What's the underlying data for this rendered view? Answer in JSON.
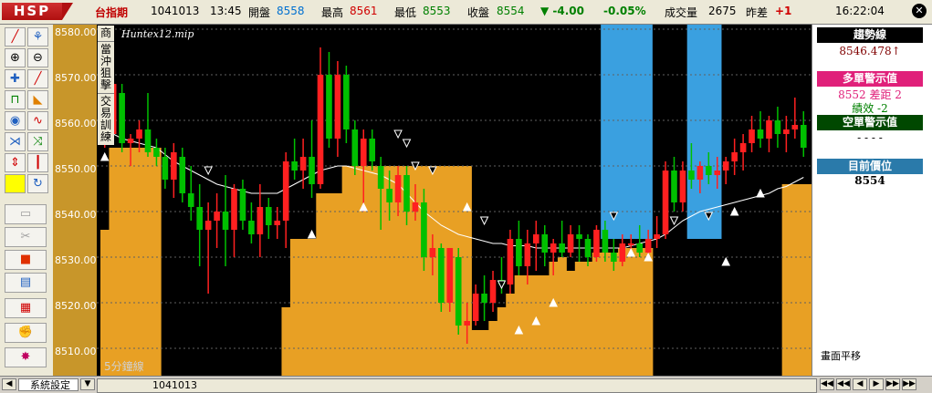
{
  "header": {
    "logo": "HSP",
    "index_name": "台指期",
    "date": "1041013",
    "time": "13:45",
    "open_label": "開盤",
    "open": "8558",
    "high_label": "最高",
    "high": "8561",
    "low_label": "最低",
    "low": "8553",
    "close_label": "收盤",
    "close": "8554",
    "change": "▼ -4.00",
    "change_pct": "-0.05%",
    "volume_label": "成交量",
    "volume": "2675",
    "diff_label": "昨差",
    "diff": "+1",
    "clock": "16:22:04",
    "close_icon": "✕"
  },
  "toolbar": {
    "icons": [
      "line-draw-icon",
      "trend-icon",
      "zoom-in-icon",
      "zoom-out-icon",
      "crosshair-icon",
      "ruler-icon",
      "lock-icon",
      "pencil-icon",
      "indicator-icon",
      "wave-icon",
      "fan-icon",
      "cross-arrows-icon",
      "updown-icon",
      "candles-icon",
      "color-square-icon",
      "refresh-icon",
      "folder-icon",
      "scissors-icon",
      "stop-icon",
      "calendar-icon",
      "table-icon",
      "gloves-icon",
      "star-icon"
    ]
  },
  "chart": {
    "title": "Huntex12.mip",
    "side_label": [
      "商",
      "當沖狙擊",
      "交易訓練"
    ],
    "period": "5分鐘線",
    "y_ticks": [
      "8580.00",
      "8570.00",
      "8560.00",
      "8550.00",
      "8540.00",
      "8530.00",
      "8520.00",
      "8510.00"
    ]
  },
  "chart_data": {
    "type": "candlestick",
    "title": "",
    "ylim": [
      8506,
      8582
    ],
    "y_ticks": [
      8580,
      8570,
      8560,
      8550,
      8540,
      8530,
      8520,
      8510
    ],
    "candles": [
      [
        8556.5,
        8560,
        8554,
        8557
      ],
      [
        8557,
        8572,
        8555,
        8568
      ],
      [
        8566,
        8568,
        8553,
        8555
      ],
      [
        8555,
        8557,
        8550,
        8556
      ],
      [
        8556,
        8560,
        8553,
        8558
      ],
      [
        8558,
        8566,
        8552,
        8553
      ],
      [
        8554,
        8556,
        8550,
        8552
      ],
      [
        8552,
        8554,
        8545,
        8547
      ],
      [
        8547,
        8555,
        8543,
        8553
      ],
      [
        8552,
        8554,
        8542,
        8544
      ],
      [
        8544,
        8550,
        8538,
        8541
      ],
      [
        8541,
        8546,
        8528,
        8536
      ],
      [
        8536,
        8542,
        8522,
        8538
      ],
      [
        8538,
        8544,
        8532,
        8540
      ],
      [
        8540,
        8548,
        8528,
        8536
      ],
      [
        8536,
        8546,
        8530,
        8545
      ],
      [
        8545,
        8547,
        8536,
        8538
      ],
      [
        8538,
        8542,
        8533,
        8535
      ],
      [
        8535,
        8546,
        8530,
        8541
      ],
      [
        8541,
        8543,
        8534,
        8537
      ],
      [
        8537,
        8541,
        8534,
        8538
      ],
      [
        8538,
        8553,
        8532,
        8551
      ],
      [
        8551,
        8556,
        8547,
        8549
      ],
      [
        8549,
        8556,
        8545,
        8552
      ],
      [
        8552,
        8560,
        8543,
        8546
      ],
      [
        8546,
        8576,
        8545,
        8570
      ],
      [
        8570,
        8575,
        8554,
        8556
      ],
      [
        8556,
        8573,
        8552,
        8570
      ],
      [
        8570,
        8572,
        8555,
        8558
      ],
      [
        8558,
        8560,
        8548,
        8550
      ],
      [
        8550,
        8558,
        8540,
        8556
      ],
      [
        8556,
        8558,
        8549,
        8551
      ],
      [
        8550,
        8552,
        8536,
        8545
      ],
      [
        8545,
        8549,
        8538,
        8542
      ],
      [
        8542,
        8550,
        8539,
        8548
      ],
      [
        8548,
        8550,
        8537,
        8540
      ],
      [
        8540,
        8546,
        8538,
        8542
      ],
      [
        8542,
        8545,
        8527,
        8530
      ],
      [
        8530,
        8535,
        8526,
        8532
      ],
      [
        8532,
        8533,
        8518,
        8520
      ],
      [
        8520,
        8530,
        8518,
        8532
      ],
      [
        8530,
        8532,
        8513,
        8515
      ],
      [
        8515,
        8520,
        8511,
        8516
      ],
      [
        8516,
        8524,
        8515,
        8522
      ],
      [
        8522,
        8526,
        8516,
        8520
      ],
      [
        8520,
        8527,
        8518,
        8525
      ],
      [
        8525,
        8530,
        8522,
        8524
      ],
      [
        8524,
        8536,
        8522,
        8534
      ],
      [
        8534,
        8538,
        8526,
        8528
      ],
      [
        8528,
        8536,
        8524,
        8533
      ],
      [
        8533,
        8538,
        8527,
        8535
      ],
      [
        8535,
        8537,
        8528,
        8531
      ],
      [
        8531,
        8534,
        8526,
        8533
      ],
      [
        8533,
        8538,
        8530,
        8531
      ],
      [
        8531,
        8537,
        8530,
        8535
      ],
      [
        8535,
        8537,
        8529,
        8534
      ],
      [
        8534,
        8535,
        8528,
        8530
      ],
      [
        8530,
        8537,
        8529,
        8536
      ],
      [
        8536,
        8538,
        8529,
        8531
      ],
      [
        8531,
        8534,
        8527,
        8529
      ],
      [
        8529,
        8535,
        8528,
        8533
      ],
      [
        8533,
        8535,
        8531,
        8533
      ],
      [
        8533,
        8537,
        8530,
        8531
      ],
      [
        8531,
        8536,
        8530,
        8534
      ],
      [
        8534,
        8539,
        8532,
        8535
      ],
      [
        8535,
        8551,
        8534,
        8549
      ],
      [
        8549,
        8552,
        8540,
        8542
      ],
      [
        8542,
        8551,
        8540,
        8549
      ],
      [
        8549,
        8555,
        8545,
        8547
      ],
      [
        8547,
        8551,
        8544,
        8550
      ],
      [
        8550,
        8553,
        8546,
        8548
      ],
      [
        8548,
        8552,
        8545,
        8549
      ],
      [
        8549,
        8552,
        8546,
        8551
      ],
      [
        8551,
        8556,
        8548,
        8553
      ],
      [
        8553,
        8557,
        8549,
        8555
      ],
      [
        8555,
        8561,
        8553,
        8558
      ],
      [
        8558,
        8562,
        8554,
        8556
      ],
      [
        8556,
        8561,
        8553,
        8560
      ],
      [
        8560,
        8563,
        8554,
        8557
      ],
      [
        8557,
        8561,
        8553,
        8558
      ],
      [
        8558,
        8565,
        8556,
        8559
      ],
      [
        8559,
        8562,
        8552,
        8554
      ]
    ],
    "stop_line": [
      8536,
      8554,
      8554,
      8554,
      8554,
      8554,
      8554,
      null,
      null,
      null,
      null,
      null,
      null,
      null,
      null,
      null,
      null,
      null,
      null,
      null,
      null,
      8519,
      8534,
      8534,
      8534,
      8544,
      8544,
      8544,
      8550,
      8550,
      8550,
      8550,
      8550,
      8550,
      8550,
      8550,
      8550,
      8550,
      8550,
      8550,
      8550,
      8550,
      8550,
      8514,
      8514,
      8516,
      8519,
      8522,
      8526,
      8526,
      8526,
      8526,
      8529,
      8530,
      8527,
      8529,
      8529,
      8531,
      8531,
      8531,
      8532,
      8532,
      8532,
      8532,
      null,
      null,
      null,
      null,
      null,
      null,
      null,
      null,
      null,
      null,
      null,
      null,
      null,
      null,
      null,
      8546,
      8546,
      8546,
      8546,
      8546
    ],
    "trend_line": [
      8557,
      8557,
      8556,
      8555.5,
      8555,
      8554.5,
      8554,
      8552.5,
      8551,
      8550,
      8549,
      8548,
      8547,
      8546,
      8545.5,
      8545,
      8544.5,
      8544,
      8544,
      8544,
      8544,
      8545,
      8546,
      8547,
      8548,
      8549,
      8549.5,
      8550,
      8550,
      8549.5,
      8549,
      8548.5,
      8548,
      8547,
      8546,
      8544,
      8542,
      8540,
      8538.5,
      8537,
      8536,
      8535,
      8534.5,
      8534,
      8533.5,
      8533,
      8533,
      8532.5,
      8532.5,
      8532.5,
      8532,
      8532,
      8532,
      8532,
      8532,
      8532,
      8532,
      8532,
      8532,
      8532,
      8532,
      8532.5,
      8533,
      8533.5,
      8534,
      8535,
      8536.5,
      8538,
      8539,
      8540,
      8540.5,
      8541,
      8541.5,
      8542,
      8542.5,
      8543,
      8543.5,
      8544,
      8545,
      8545.5,
      8546.5,
      8547.5
    ],
    "markers": [
      {
        "i": 0,
        "type": "up",
        "price": 8552
      },
      {
        "i": 12,
        "type": "down",
        "price": 8549
      },
      {
        "i": 24,
        "type": "up",
        "price": 8535
      },
      {
        "i": 30,
        "type": "up",
        "price": 8541
      },
      {
        "i": 34,
        "type": "down",
        "price": 8557
      },
      {
        "i": 35,
        "type": "down",
        "price": 8555
      },
      {
        "i": 36,
        "type": "down",
        "price": 8550
      },
      {
        "i": 38,
        "type": "down",
        "price": 8549
      },
      {
        "i": 42,
        "type": "up",
        "price": 8541
      },
      {
        "i": 44,
        "type": "down",
        "price": 8538
      },
      {
        "i": 46,
        "type": "down",
        "price": 8524
      },
      {
        "i": 48,
        "type": "up",
        "price": 8514
      },
      {
        "i": 50,
        "type": "up",
        "price": 8516
      },
      {
        "i": 52,
        "type": "up",
        "price": 8520
      },
      {
        "i": 59,
        "type": "down",
        "price": 8539
      },
      {
        "i": 61,
        "type": "up",
        "price": 8531
      },
      {
        "i": 63,
        "type": "up",
        "price": 8530
      },
      {
        "i": 66,
        "type": "down",
        "price": 8538
      },
      {
        "i": 70,
        "type": "down",
        "price": 8539
      },
      {
        "i": 72,
        "type": "up",
        "price": 8529
      },
      {
        "i": 73,
        "type": "up",
        "price": 8540
      },
      {
        "i": 76,
        "type": "up",
        "price": 8544
      }
    ],
    "blue_zones": [
      [
        58,
        63
      ],
      [
        68,
        71
      ]
    ],
    "colors": {
      "up": "#ff2020",
      "down": "#00c000",
      "stop_fill": "#e8a024",
      "zone": "#3aa0e0",
      "trend": "#ffffff",
      "bg": "#000000"
    }
  },
  "panel": {
    "trend_title": "趨勢線",
    "trend_value": "8546.478↑",
    "long_title": "多單警示值",
    "long_line": "8552   差距  2",
    "long_perf": "績效   -2",
    "short_title": "空單警示值",
    "short_value": "- - - -",
    "position_title": "目前價位",
    "position_value": "8554",
    "scroll_note": "畫面平移"
  },
  "bottom": {
    "settings_label": "系統設定",
    "date_label": "1041013",
    "nav": [
      "◀◀",
      "◀◀",
      "◀",
      "▶",
      "▶▶",
      "▶▶"
    ]
  }
}
